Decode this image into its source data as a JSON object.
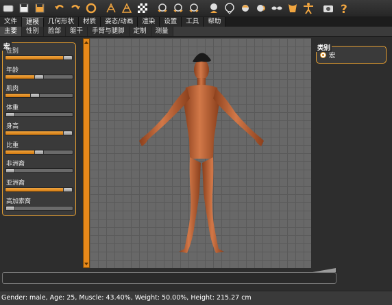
{
  "toolbar": {
    "icons": [
      "folder-icon",
      "save-icon",
      "export-icon",
      "undo-icon",
      "redo-icon",
      "reset-icon",
      "wireframe-icon",
      "mesh-icon",
      "checker-icon",
      "front-view-icon",
      "back-view-icon",
      "side-view-icon",
      "face-icon",
      "head-icon",
      "hair-icon",
      "ear-icon",
      "eyes-icon",
      "torso-icon",
      "pose-icon",
      "camera-icon",
      "help-icon"
    ]
  },
  "menu": {
    "tabs": [
      "文件",
      "建模",
      "几何形状",
      "材质",
      "姿态/动画",
      "渲染",
      "设置",
      "工具",
      "帮助"
    ],
    "active_index": 1
  },
  "submenu": {
    "tabs": [
      "主要",
      "性别",
      "脸部",
      "躯干",
      "手臂与腿脚",
      "定制",
      "测量"
    ],
    "active_index": 0
  },
  "macro": {
    "title": "宏",
    "sliders": [
      {
        "label": "性别",
        "value": 1.0
      },
      {
        "label": "年龄",
        "value": 0.5
      },
      {
        "label": "肌肉",
        "value": 0.434
      },
      {
        "label": "体重",
        "value": 0.0
      },
      {
        "label": "身高",
        "value": 1.0
      },
      {
        "label": "比重",
        "value": 0.5
      },
      {
        "label": "非洲裔",
        "value": 0.0
      },
      {
        "label": "亚洲裔",
        "value": 1.0
      },
      {
        "label": "高加索裔",
        "value": 0.0
      }
    ]
  },
  "category": {
    "title": "类别",
    "option": "宏"
  },
  "status": {
    "text": "Gender: male, Age: 25, Muscle: 43.40%, Weight: 50.00%, Height: 215.27 cm"
  },
  "colors": {
    "accent": "#e8891a",
    "skin": "#c86a3a",
    "viewport": "#686868"
  }
}
